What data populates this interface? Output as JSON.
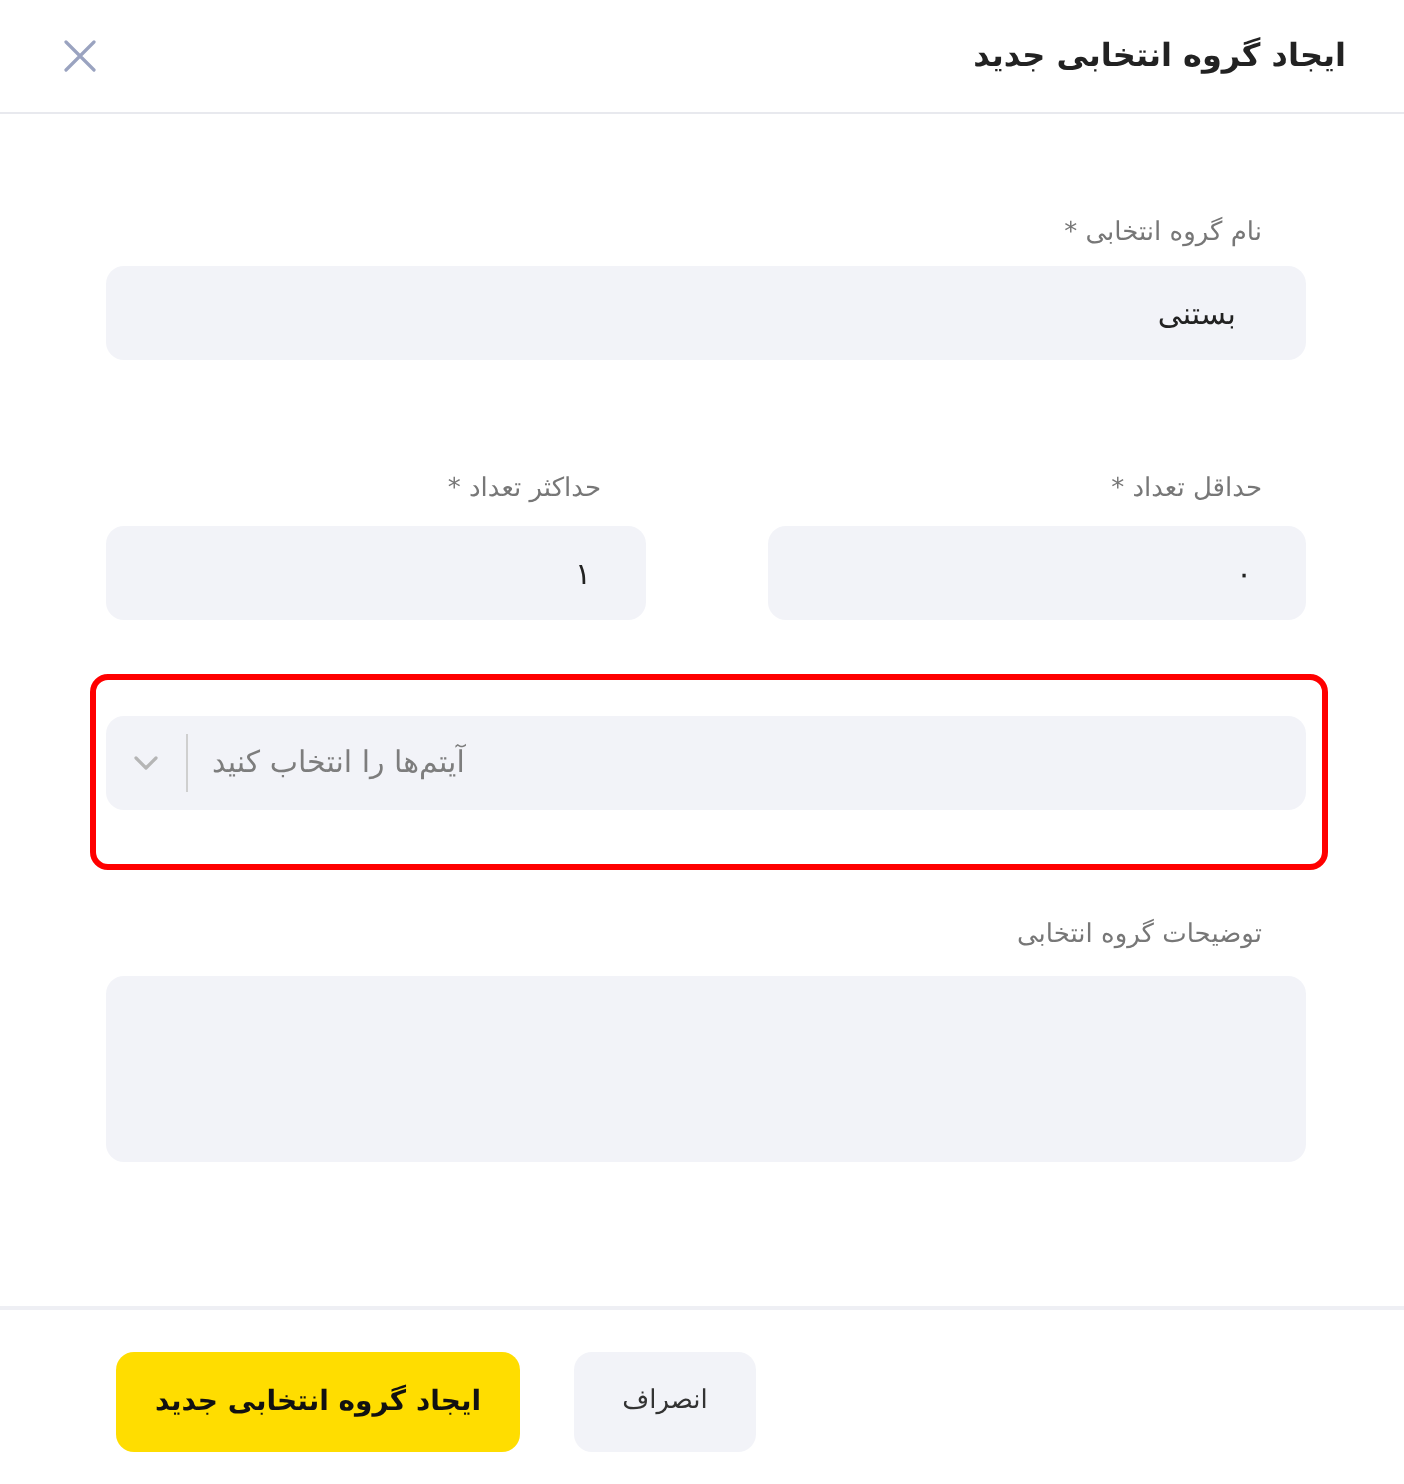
{
  "dialog": {
    "title": "ایجاد گروه انتخابی جدید"
  },
  "form": {
    "name_field": {
      "label": "نام گروه انتخابی *",
      "value": "بستنی"
    },
    "count_fields": [
      {
        "label": "حداقل تعداد *",
        "value": "۰"
      },
      {
        "label": "حداکثر تعداد *",
        "value": "۱"
      }
    ],
    "items_select": {
      "placeholder": "آیتم‌ها را انتخاب کنید",
      "highlighted": true
    },
    "description_field": {
      "label": "توضیحات گروه انتخابی"
    }
  },
  "buttons": [
    {
      "label": "انصراف",
      "kind": "secondary"
    },
    {
      "label": "ایجاد گروه انتخابی جدید",
      "kind": "primary"
    }
  ]
}
